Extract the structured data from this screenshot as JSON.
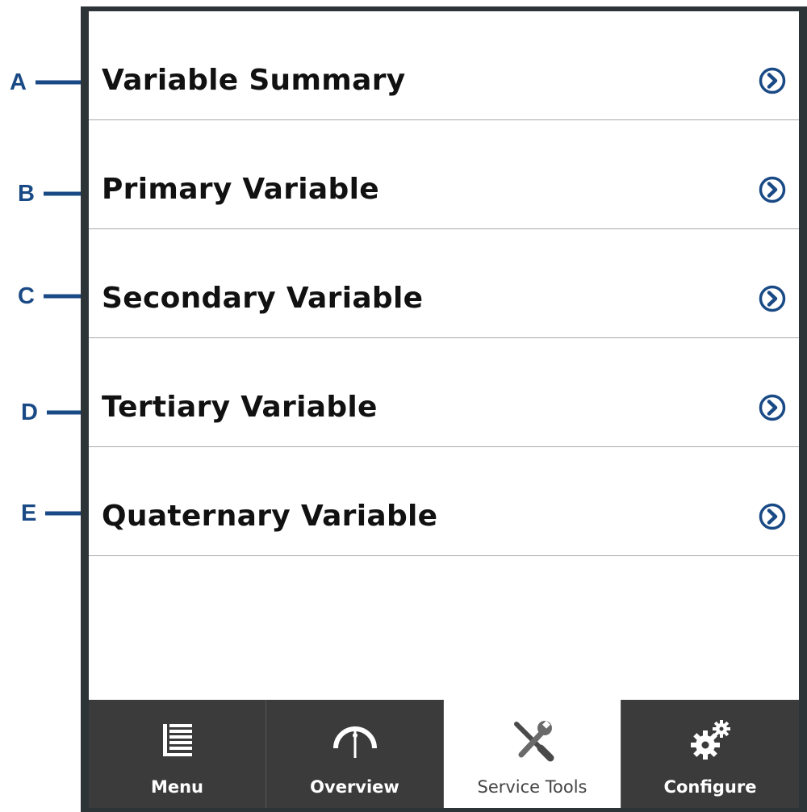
{
  "callouts": [
    {
      "letter": "A",
      "icon": "arrow-right-icon"
    },
    {
      "letter": "B",
      "icon": "arrow-right-icon"
    },
    {
      "letter": "C",
      "icon": "arrow-right-icon"
    },
    {
      "letter": "D",
      "icon": "arrow-right-icon"
    },
    {
      "letter": "E",
      "icon": "arrow-right-icon"
    }
  ],
  "menu": {
    "items": [
      {
        "label": "Variable Summary",
        "icon": "chevron-right-icon"
      },
      {
        "label": "Primary Variable",
        "icon": "chevron-right-icon"
      },
      {
        "label": "Secondary Variable",
        "icon": "chevron-right-icon"
      },
      {
        "label": "Tertiary Variable",
        "icon": "chevron-right-icon"
      },
      {
        "label": "Quaternary Variable",
        "icon": "chevron-right-icon"
      }
    ]
  },
  "tabs": [
    {
      "label": "Menu",
      "icon": "menu-list-icon",
      "active": false
    },
    {
      "label": "Overview",
      "icon": "gauge-icon",
      "active": false
    },
    {
      "label": "Service Tools",
      "icon": "tools-icon",
      "active": true
    },
    {
      "label": "Configure",
      "icon": "gears-icon",
      "active": false
    }
  ],
  "colors": {
    "callout": "#1a4a85",
    "chevron": "#1a4a85",
    "frame": "#2d3438",
    "tab_background": "#3b3b3b",
    "tab_active_background": "#ffffff"
  }
}
